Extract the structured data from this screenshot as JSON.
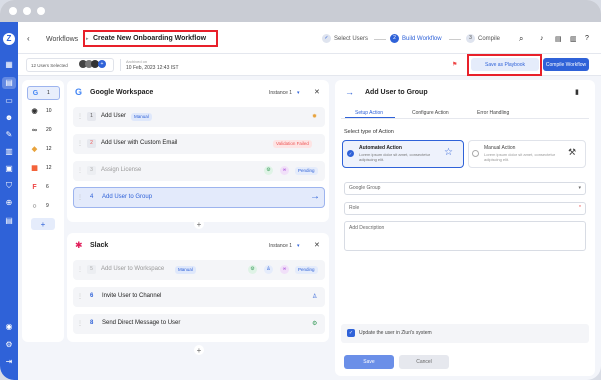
{
  "breadcrumb": {
    "parent": "Workflows",
    "current": "Create New Onboarding Workflow"
  },
  "steps": [
    {
      "label": "Select Users",
      "marker": "✓"
    },
    {
      "label": "Build Workflow",
      "marker": "2"
    },
    {
      "label": "Compile",
      "marker": "3"
    }
  ],
  "subbar": {
    "users_selected": "12 Users Selected",
    "avatar_extra": "+",
    "archived_label": "Archived on",
    "archived_date": "10 Feb, 2023 12:43 IST",
    "save_playbook": "Save as Playbook",
    "compile_workflow": "Compile Workflow"
  },
  "apps": [
    {
      "logo": "G",
      "count": "1",
      "color": "#4285f4",
      "active": true
    },
    {
      "logo": "◉",
      "count": "10",
      "color": "#333"
    },
    {
      "logo": "∞",
      "count": "20",
      "color": "#333"
    },
    {
      "logo": "◆",
      "count": "12",
      "color": "#e8a33d"
    },
    {
      "logo": "▦",
      "count": "12",
      "color": "#f25022"
    },
    {
      "logo": "F",
      "count": "6",
      "color": "#e44"
    },
    {
      "logo": "○",
      "count": "9",
      "color": "#222"
    },
    {
      "logo": "◉",
      "count": "20",
      "color": "#7a4"
    }
  ],
  "add_app": "+",
  "gworkspace": {
    "title": "Google Workspace",
    "instance": "Instance 1",
    "close": "✕",
    "actions": [
      {
        "num": "1",
        "label": "Add User",
        "badge": "Manual"
      },
      {
        "num": "2",
        "label": "Add User with Custom Email",
        "status": "Validation Failed"
      },
      {
        "num": "3",
        "label": "Assign License",
        "status": "Pending"
      },
      {
        "num": "4",
        "label": "Add User to Group",
        "arrow": "→"
      }
    ],
    "add": "+"
  },
  "slack": {
    "title": "Slack",
    "instance": "Instance 1",
    "close": "✕",
    "actions": [
      {
        "num": "5",
        "label": "Add User to Workspace",
        "badge": "Manual",
        "status": "Pending"
      },
      {
        "num": "6",
        "label": "Invite User to Channel"
      },
      {
        "num": "8",
        "label": "Send Direct Message to User"
      }
    ],
    "add": "+"
  },
  "panel": {
    "title": "Add User to Group",
    "tabs": [
      "Setup Action",
      "Configure Action",
      "Error Handling"
    ],
    "section_label": "Select type of Action",
    "automated": {
      "title": "Automated Action",
      "desc": "Lorem ipsum dolor sit amet, consectetur adipiscing elit."
    },
    "manual": {
      "title": "Manual Action",
      "desc": "Lorem ipsum dolor sit amet, consectetur adipiscing elit."
    },
    "group_placeholder": "Google Group",
    "role_placeholder": "Role",
    "role_required": "*",
    "description_placeholder": "Add Description",
    "update_checkbox": "Update the user in Zluri's system",
    "save": "Save",
    "cancel": "Cancel"
  },
  "colors": {
    "accent": "#2f62d8",
    "highlight": "#e8202a"
  }
}
